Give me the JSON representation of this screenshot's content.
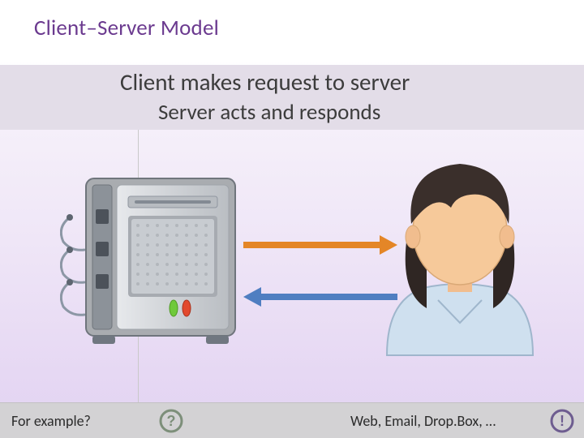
{
  "title": "Client–Server Model",
  "line1": "Client makes request to server",
  "line2": "Server acts and responds",
  "icons": {
    "server": "server-icon",
    "client": "person-icon",
    "request_arrow": "arrow-right-icon",
    "response_arrow": "arrow-left-icon",
    "question": "question-circle-icon",
    "exclaim": "exclaim-circle-icon"
  },
  "colors": {
    "title": "#6b3a8f",
    "band": "#e3dde8",
    "request_arrow": "#e48627",
    "response_arrow": "#4f7ec1",
    "server_body": "#a9acb0",
    "server_face": "#cfd2d6",
    "led_green": "#6fc93a",
    "led_red": "#e2492d",
    "person_skin": "#f6c99a",
    "person_hair": "#3a2f2b",
    "person_shirt": "#cfe0ef",
    "footer_bg": "#d3d2d4",
    "q_icon": "#7d8f7a",
    "ex_icon": "#6e5d90"
  },
  "footer": {
    "prompt": "For example?",
    "examples": "Web, Email, Drop.Box, …"
  }
}
